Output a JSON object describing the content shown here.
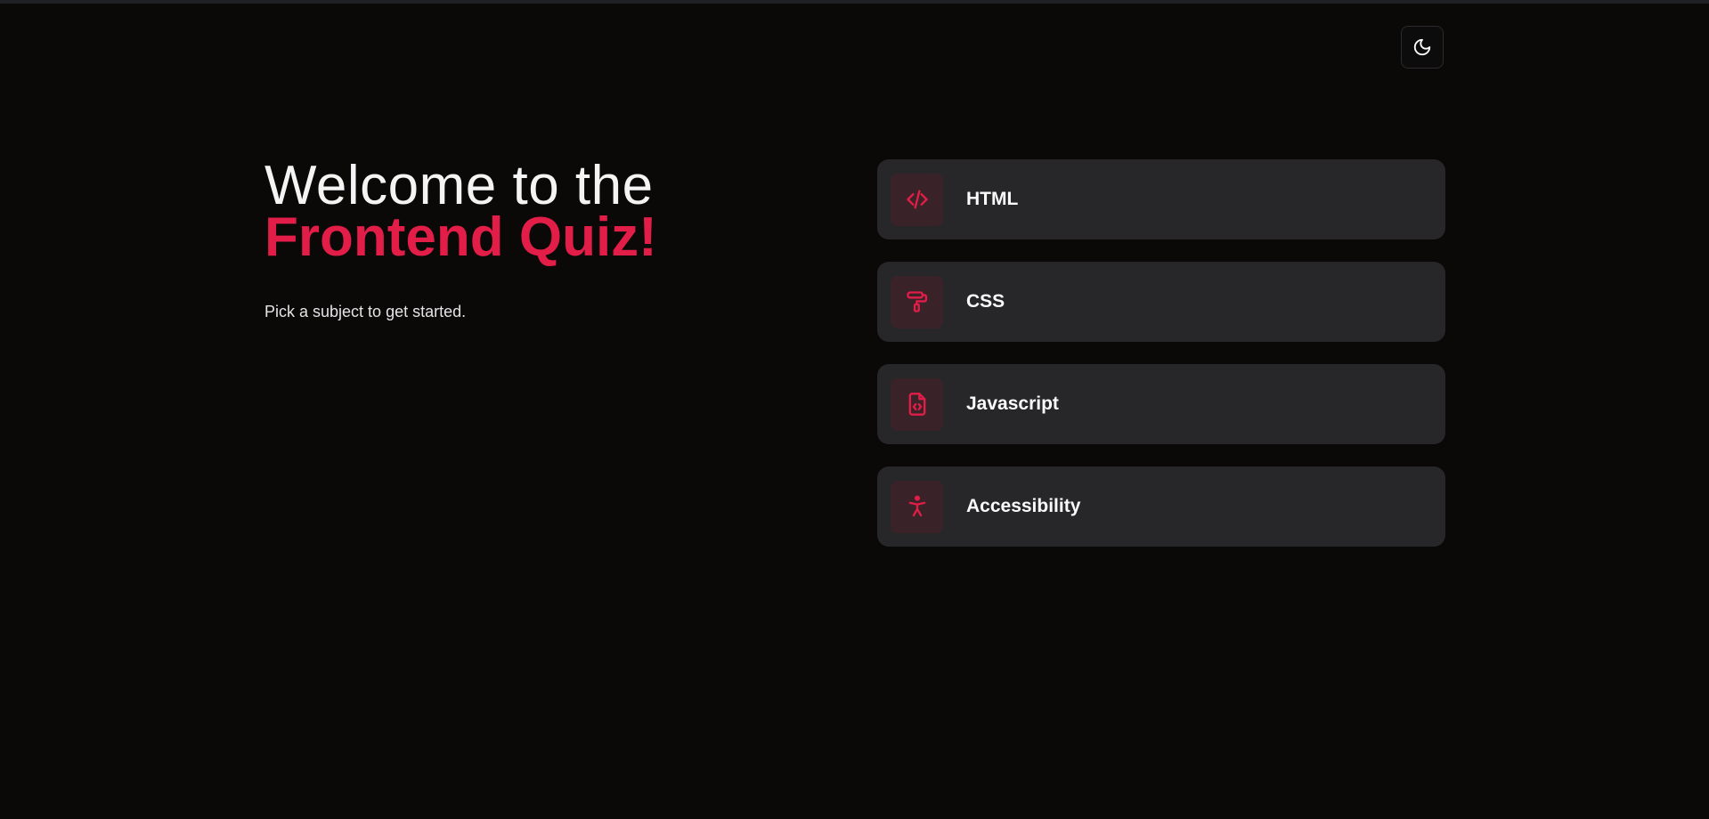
{
  "theme_toggle": {
    "icon": "moon-icon"
  },
  "hero": {
    "title_line1": "Welcome to the",
    "title_line2": "Frontend Quiz!",
    "subtitle": "Pick a subject to get started."
  },
  "subjects": [
    {
      "label": "HTML",
      "icon": "code-icon"
    },
    {
      "label": "CSS",
      "icon": "paint-roller-icon"
    },
    {
      "label": "Javascript",
      "icon": "file-code-icon"
    },
    {
      "label": "Accessibility",
      "icon": "accessibility-icon"
    }
  ],
  "colors": {
    "accent": "#e11d48",
    "background": "#0a0908",
    "card": "#27272a",
    "icon_tile": "#3a2328"
  }
}
